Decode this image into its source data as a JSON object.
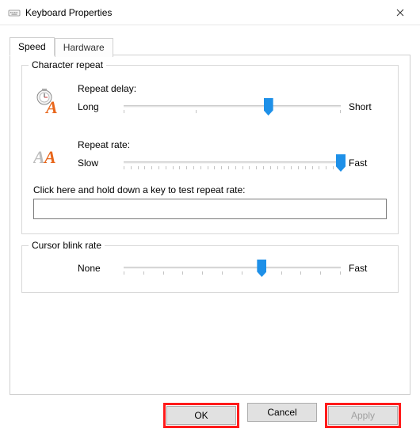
{
  "window": {
    "title": "Keyboard Properties"
  },
  "tabs": {
    "speed": "Speed",
    "hardware": "Hardware"
  },
  "character_repeat": {
    "legend": "Character repeat",
    "repeat_delay": {
      "label": "Repeat delay:",
      "min_label": "Long",
      "max_label": "Short",
      "ticks": 4,
      "value_index": 2
    },
    "repeat_rate": {
      "label": "Repeat rate:",
      "min_label": "Slow",
      "max_label": "Fast",
      "ticks": 32,
      "value_index": 31
    },
    "test_label": "Click here and hold down a key to test repeat rate:",
    "test_value": ""
  },
  "cursor_blink": {
    "legend": "Cursor blink rate",
    "slider": {
      "min_label": "None",
      "max_label": "Fast",
      "ticks": 12,
      "value_index": 7
    }
  },
  "buttons": {
    "ok": "OK",
    "cancel": "Cancel",
    "apply": "Apply"
  }
}
